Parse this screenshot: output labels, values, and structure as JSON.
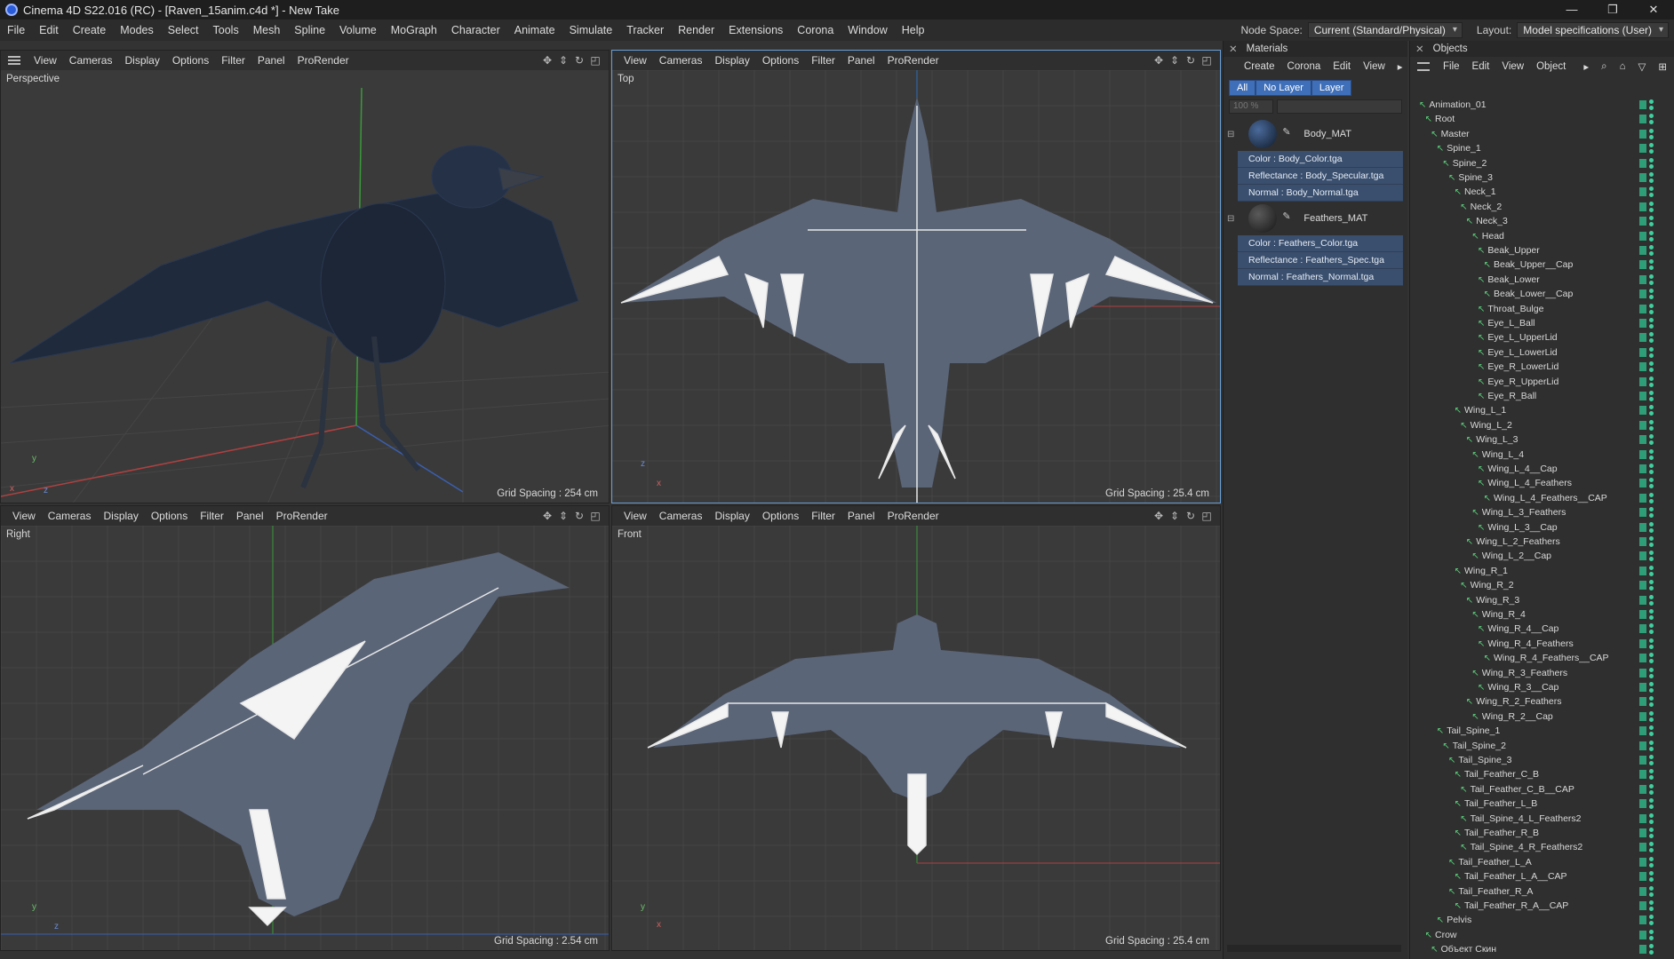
{
  "titlebar": {
    "title": "Cinema 4D S22.016 (RC) - [Raven_15anim.c4d *] - New Take"
  },
  "window_controls": [
    "—",
    "❐",
    "✕"
  ],
  "menu": [
    "File",
    "Edit",
    "Create",
    "Modes",
    "Select",
    "Tools",
    "Mesh",
    "Spline",
    "Volume",
    "MoGraph",
    "Character",
    "Animate",
    "Simulate",
    "Tracker",
    "Render",
    "Extensions",
    "Corona",
    "Window",
    "Help"
  ],
  "menu_right": {
    "node_space_label": "Node Space:",
    "node_space_value": "Current (Standard/Physical)",
    "layout_label": "Layout:",
    "layout_value": "Model specifications (User)"
  },
  "viewports": {
    "perspective": {
      "menu": [
        "View",
        "Cameras",
        "Display",
        "Options",
        "Filter",
        "Panel",
        "ProRender"
      ],
      "name": "Perspective",
      "grid": "Grid Spacing : 254 cm"
    },
    "top": {
      "menu": [
        "View",
        "Cameras",
        "Display",
        "Options",
        "Filter",
        "Panel",
        "ProRender"
      ],
      "name": "Top",
      "grid": "Grid Spacing : 25.4 cm"
    },
    "right": {
      "menu": [
        "View",
        "Cameras",
        "Display",
        "Options",
        "Filter",
        "Panel",
        "ProRender"
      ],
      "name": "Right",
      "grid": "Grid Spacing : 2.54 cm"
    },
    "front": {
      "menu": [
        "View",
        "Cameras",
        "Display",
        "Options",
        "Filter",
        "Panel",
        "ProRender"
      ],
      "name": "Front",
      "grid": "Grid Spacing : 25.4 cm"
    }
  },
  "materials": {
    "title": "Materials",
    "menu": [
      "Create",
      "Corona",
      "Edit",
      "View"
    ],
    "tabs": [
      "All",
      "No Layer",
      "Layer"
    ],
    "zoom": "100 %",
    "items": [
      {
        "name": "Body_MAT",
        "channels": [
          "Color : Body_Color.tga",
          "Reflectance : Body_Specular.tga",
          "Normal : Body_Normal.tga"
        ]
      },
      {
        "name": "Feathers_MAT",
        "channels": [
          "Color : Feathers_Color.tga",
          "Reflectance : Feathers_Spec.tga",
          "Normal : Feathers_Normal.tga"
        ]
      }
    ]
  },
  "objects": {
    "title": "Objects",
    "menu": [
      "File",
      "Edit",
      "View",
      "Object"
    ],
    "items": [
      {
        "label": "Animation_01",
        "depth": 0
      },
      {
        "label": "Root",
        "depth": 1
      },
      {
        "label": "Master",
        "depth": 2
      },
      {
        "label": "Spine_1",
        "depth": 3
      },
      {
        "label": "Spine_2",
        "depth": 4
      },
      {
        "label": "Spine_3",
        "depth": 5
      },
      {
        "label": "Neck_1",
        "depth": 6
      },
      {
        "label": "Neck_2",
        "depth": 7
      },
      {
        "label": "Neck_3",
        "depth": 8
      },
      {
        "label": "Head",
        "depth": 9
      },
      {
        "label": "Beak_Upper",
        "depth": 10
      },
      {
        "label": "Beak_Upper__Cap",
        "depth": 11
      },
      {
        "label": "Beak_Lower",
        "depth": 10
      },
      {
        "label": "Beak_Lower__Cap",
        "depth": 11
      },
      {
        "label": "Throat_Bulge",
        "depth": 10
      },
      {
        "label": "Eye_L_Ball",
        "depth": 10
      },
      {
        "label": "Eye_L_UpperLid",
        "depth": 10
      },
      {
        "label": "Eye_L_LowerLid",
        "depth": 10
      },
      {
        "label": "Eye_R_LowerLid",
        "depth": 10
      },
      {
        "label": "Eye_R_UpperLid",
        "depth": 10
      },
      {
        "label": "Eye_R_Ball",
        "depth": 10
      },
      {
        "label": "Wing_L_1",
        "depth": 6
      },
      {
        "label": "Wing_L_2",
        "depth": 7
      },
      {
        "label": "Wing_L_3",
        "depth": 8
      },
      {
        "label": "Wing_L_4",
        "depth": 9
      },
      {
        "label": "Wing_L_4__Cap",
        "depth": 10
      },
      {
        "label": "Wing_L_4_Feathers",
        "depth": 10
      },
      {
        "label": "Wing_L_4_Feathers__CAP",
        "depth": 11
      },
      {
        "label": "Wing_L_3_Feathers",
        "depth": 9
      },
      {
        "label": "Wing_L_3__Cap",
        "depth": 10
      },
      {
        "label": "Wing_L_2_Feathers",
        "depth": 8
      },
      {
        "label": "Wing_L_2__Cap",
        "depth": 9
      },
      {
        "label": "Wing_R_1",
        "depth": 6
      },
      {
        "label": "Wing_R_2",
        "depth": 7
      },
      {
        "label": "Wing_R_3",
        "depth": 8
      },
      {
        "label": "Wing_R_4",
        "depth": 9
      },
      {
        "label": "Wing_R_4__Cap",
        "depth": 10
      },
      {
        "label": "Wing_R_4_Feathers",
        "depth": 10
      },
      {
        "label": "Wing_R_4_Feathers__CAP",
        "depth": 11
      },
      {
        "label": "Wing_R_3_Feathers",
        "depth": 9
      },
      {
        "label": "Wing_R_3__Cap",
        "depth": 10
      },
      {
        "label": "Wing_R_2_Feathers",
        "depth": 8
      },
      {
        "label": "Wing_R_2__Cap",
        "depth": 9
      },
      {
        "label": "Tail_Spine_1",
        "depth": 3
      },
      {
        "label": "Tail_Spine_2",
        "depth": 4
      },
      {
        "label": "Tail_Spine_3",
        "depth": 5
      },
      {
        "label": "Tail_Feather_C_B",
        "depth": 6
      },
      {
        "label": "Tail_Feather_C_B__CAP",
        "depth": 7
      },
      {
        "label": "Tail_Feather_L_B",
        "depth": 6
      },
      {
        "label": "Tail_Spine_4_L_Feathers2",
        "depth": 7
      },
      {
        "label": "Tail_Feather_R_B",
        "depth": 6
      },
      {
        "label": "Tail_Spine_4_R_Feathers2",
        "depth": 7
      },
      {
        "label": "Tail_Feather_L_A",
        "depth": 5
      },
      {
        "label": "Tail_Feather_L_A__CAP",
        "depth": 6
      },
      {
        "label": "Tail_Feather_R_A",
        "depth": 5
      },
      {
        "label": "Tail_Feather_R_A__CAP",
        "depth": 6
      },
      {
        "label": "Pelvis",
        "depth": 3
      },
      {
        "label": "Crow",
        "depth": 1
      },
      {
        "label": "Объект Скин",
        "depth": 2
      }
    ]
  },
  "colors": {
    "accent": "#3f6fb8",
    "bg": "#333333",
    "panel": "#2f2f2f",
    "bone": "#5ad07a",
    "active_border": "#6aa0d8"
  }
}
